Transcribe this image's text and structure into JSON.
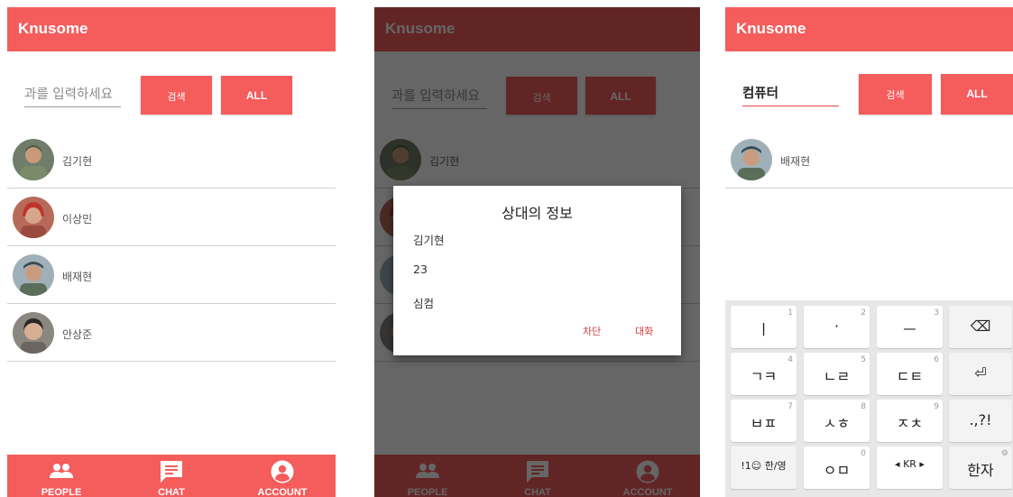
{
  "app_title": "Knusome",
  "search": {
    "placeholder": "과를 입력하세요",
    "typed_value": "컴퓨터",
    "search_label": "검색",
    "all_label": "ALL"
  },
  "people": [
    {
      "name": "김기현"
    },
    {
      "name": "이상민"
    },
    {
      "name": "배재현"
    },
    {
      "name": "안상준"
    }
  ],
  "search_result": [
    {
      "name": "배재현"
    }
  ],
  "nav": {
    "people": "PEOPLE",
    "chat": "CHAT",
    "account": "ACCOUNT"
  },
  "dialog": {
    "title": "상대의 정보",
    "name": "김기현",
    "age": "23",
    "department": "심컴",
    "block_label": "차단",
    "chat_label": "대화"
  },
  "keyboard": {
    "rows": [
      [
        {
          "main": "ㅣ",
          "hint": "1"
        },
        {
          "main": "·",
          "hint": "2"
        },
        {
          "main": "ㅡ",
          "hint": "3"
        },
        {
          "main": "⌫",
          "hint": ""
        }
      ],
      [
        {
          "main": "ㄱㅋ",
          "hint": "4"
        },
        {
          "main": "ㄴㄹ",
          "hint": "5"
        },
        {
          "main": "ㄷㅌ",
          "hint": "6"
        },
        {
          "main": "⏎",
          "hint": ""
        }
      ],
      [
        {
          "main": "ㅂㅍ",
          "hint": "7"
        },
        {
          "main": "ㅅㅎ",
          "hint": "8"
        },
        {
          "main": "ㅈㅊ",
          "hint": "9"
        },
        {
          "main": ".,?!",
          "hint": ""
        }
      ],
      [
        {
          "main": "!1☺  한/영",
          "hint": ""
        },
        {
          "main": "ㅇㅁ",
          "hint": "0"
        },
        {
          "main": "◂ KR ▸",
          "hint": ""
        },
        {
          "main": "한자",
          "hint": "⚙"
        }
      ]
    ]
  },
  "colors": {
    "accent": "#f55c5c",
    "dialog_action": "#d23c3c"
  }
}
